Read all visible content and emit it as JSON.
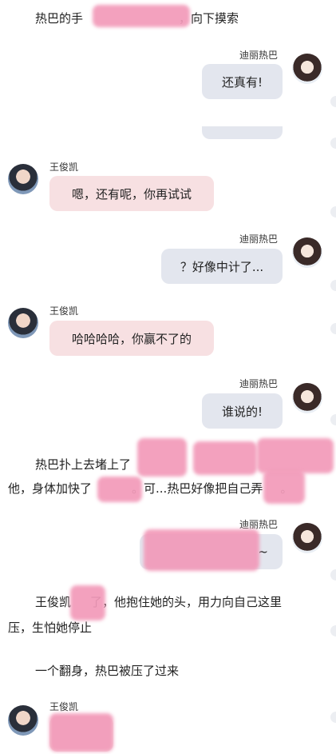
{
  "chat": {
    "narration_1": "热巴的手",
    "narration_1b": "，向下摸索",
    "msg_1": {
      "sender": "迪丽热巴",
      "text": "还真有!"
    },
    "msg_2": {
      "sender": "王俊凯",
      "text": "嗯，还有呢，你再试试"
    },
    "msg_3": {
      "sender": "迪丽热巴",
      "text": "？好像中计了..."
    },
    "msg_4": {
      "sender": "王俊凯",
      "text": "哈哈哈哈，你赢不了的"
    },
    "msg_5": {
      "sender": "迪丽热巴",
      "text": "谁说的!"
    },
    "narration_2a": "热巴扑上去堵上了",
    "narration_2b": "他，身体加快了",
    "narration_2c": "。可...热巴好像把自己弄",
    "narration_2d": "。",
    "msg_6": {
      "sender": "迪丽热巴",
      "text_tail": "~"
    },
    "narration_3a": "王俊凯",
    "narration_3b": "了，他抱住她的头，用力向自己这里",
    "narration_3c": "压，生怕她停止",
    "narration_4": "一个翻身，热巴被压了过来",
    "msg_7": {
      "sender": "王俊凯"
    }
  },
  "colors": {
    "left_bubble": "#f7e0e2",
    "right_bubble": "#e3e6ee",
    "redaction": "#f29ab9"
  },
  "icons": [
    "avatar-wangjunkai",
    "avatar-dilireba"
  ]
}
